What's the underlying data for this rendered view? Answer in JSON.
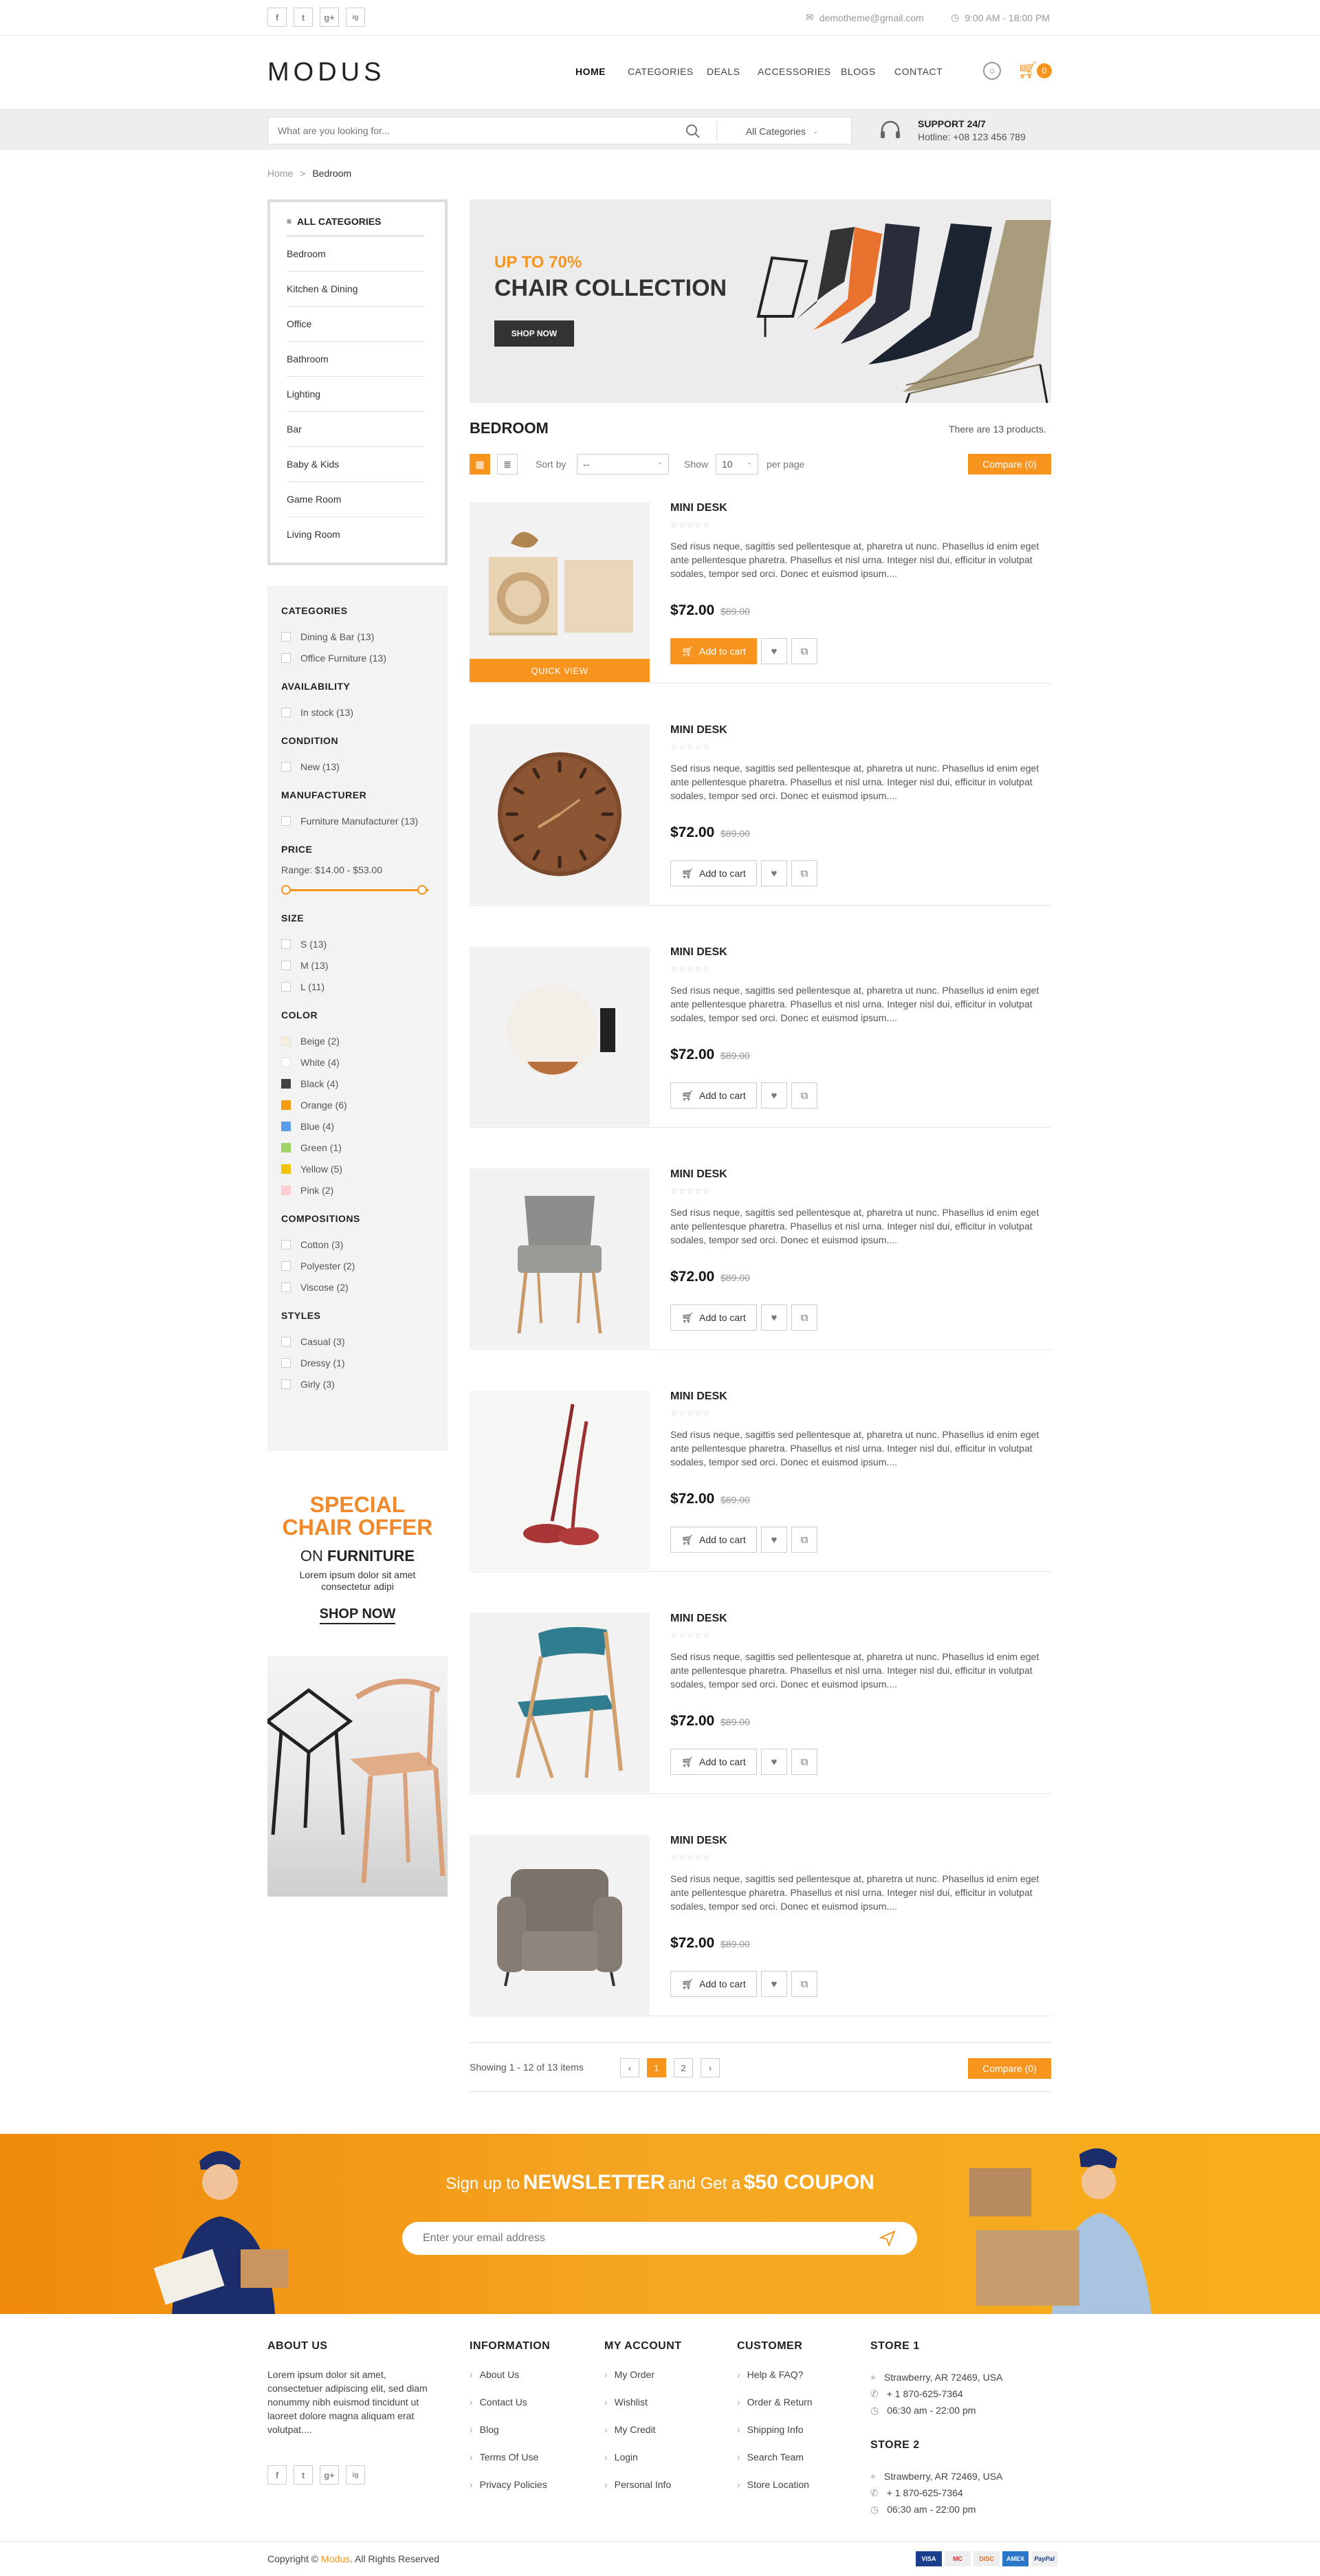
{
  "topbar": {
    "social": [
      "f",
      "t",
      "g+",
      "ig"
    ],
    "email": "demotheme@gmail.com",
    "hours": "9:00 AM - 18:00 PM"
  },
  "header": {
    "logo": "MODUS",
    "nav": [
      "HOME",
      "CATEGORIES",
      "DEALS",
      "ACCESSORIES",
      "BLOGS",
      "CONTACT"
    ],
    "cart_count": "0"
  },
  "search": {
    "placeholder": "What are you looking for...",
    "category": "All Categories",
    "support_title": "SUPPORT 24/7",
    "support_line": "Hotline: +08 123 456 789"
  },
  "breadcrumb": {
    "home": "Home",
    "sep": ">",
    "current": "Bedroom"
  },
  "sidebar": {
    "all_categories": "ALL CATEGORIES",
    "categories": [
      "Bedroom",
      "Kitchen & Dining",
      "Office",
      "Bathroom",
      "Lighting",
      "Bar",
      "Baby & Kids",
      "Game Room",
      "Living Room"
    ]
  },
  "filters": {
    "categories_title": "CATEGORIES",
    "categories": [
      "Dining & Bar (13)",
      "Office Furniture (13)"
    ],
    "availability_title": "AVAILABILITY",
    "availability": [
      "In stock (13)"
    ],
    "condition_title": "CONDITION",
    "condition": [
      "New (13)"
    ],
    "manufacturer_title": "MANUFACTURER",
    "manufacturer": [
      "Furniture Manufacturer (13)"
    ],
    "price_title": "PRICE",
    "price_range": "Range: $14.00 - $53.00",
    "size_title": "SIZE",
    "sizes": [
      "S (13)",
      "M (13)",
      "L (11)"
    ],
    "color_title": "COLOR",
    "colors": [
      {
        "label": "Beige (2)",
        "hex": "#f5f0dc"
      },
      {
        "label": "White (4)",
        "hex": "#ffffff"
      },
      {
        "label": "Black (4)",
        "hex": "#434343"
      },
      {
        "label": "Orange (6)",
        "hex": "#f39c11"
      },
      {
        "label": "Blue (4)",
        "hex": "#5d9cec"
      },
      {
        "label": "Green (1)",
        "hex": "#a0d468"
      },
      {
        "label": "Yellow (5)",
        "hex": "#f1c40f"
      },
      {
        "label": "Pink (2)",
        "hex": "#fcced2"
      }
    ],
    "compositions_title": "COMPOSITIONS",
    "compositions": [
      "Cotton (3)",
      "Polyester (2)",
      "Viscose (2)"
    ],
    "styles_title": "STYLES",
    "styles": [
      "Casual (3)",
      "Dressy (1)",
      "Girly (3)"
    ]
  },
  "promo": {
    "line1": "SPECIAL",
    "line2": "CHAIR OFFER",
    "on": "ON",
    "furniture": "FURNITURE",
    "text": "Lorem ipsum dolor sit amet consectetur adipi",
    "cta": "SHOP NOW"
  },
  "banner": {
    "discount": "UP TO 70%",
    "title": "CHAIR COLLECTION",
    "cta": "SHOP NOW"
  },
  "listing": {
    "title": "BEDROOM",
    "count": "There are 13 products.",
    "sort_label": "Sort by",
    "sort_value": "--",
    "show_label": "Show",
    "show_value": "10",
    "per_page": "per page",
    "compare": "Compare (0)"
  },
  "products": [
    {
      "name": "MINI DESK",
      "desc": "Sed risus neque, sagittis sed pellentesque at, pharetra ut nunc. Phasellus id enim eget ante pellentesque pharetra. Phasellus et nisl urna. Integer nisl dui, efficitur in volutpat sodales, tempor sed orci. Donec et euismod ipsum....",
      "price": "$72.00",
      "old_price": "$89.00",
      "add": "Add to cart",
      "quick_view": "QUICK VIEW"
    },
    {
      "name": "MINI DESK",
      "desc": "Sed risus neque, sagittis sed pellentesque at, pharetra ut nunc. Phasellus id enim eget ante pellentesque pharetra. Phasellus et nisl urna. Integer nisl dui, efficitur in volutpat sodales, tempor sed orci. Donec et euismod ipsum....",
      "price": "$72.00",
      "old_price": "$89.00",
      "add": "Add to cart"
    },
    {
      "name": "MINI DESK",
      "desc": "Sed risus neque, sagittis sed pellentesque at, pharetra ut nunc. Phasellus id enim eget ante pellentesque pharetra. Phasellus et nisl urna. Integer nisl dui, efficitur in volutpat sodales, tempor sed orci. Donec et euismod ipsum....",
      "price": "$72.00",
      "old_price": "$89.00",
      "add": "Add to cart"
    },
    {
      "name": "MINI DESK",
      "desc": "Sed risus neque, sagittis sed pellentesque at, pharetra ut nunc. Phasellus id enim eget ante pellentesque pharetra. Phasellus et nisl urna. Integer nisl dui, efficitur in volutpat sodales, tempor sed orci. Donec et euismod ipsum....",
      "price": "$72.00",
      "old_price": "$89.00",
      "add": "Add to cart"
    },
    {
      "name": "MINI DESK",
      "desc": "Sed risus neque, sagittis sed pellentesque at, pharetra ut nunc. Phasellus id enim eget ante pellentesque pharetra. Phasellus et nisl urna. Integer nisl dui, efficitur in volutpat sodales, tempor sed orci. Donec et euismod ipsum....",
      "price": "$72.00",
      "old_price": "$89.00",
      "add": "Add to cart"
    },
    {
      "name": "MINI DESK",
      "desc": "Sed risus neque, sagittis sed pellentesque at, pharetra ut nunc. Phasellus id enim eget ante pellentesque pharetra. Phasellus et nisl urna. Integer nisl dui, efficitur in volutpat sodales, tempor sed orci. Donec et euismod ipsum....",
      "price": "$72.00",
      "old_price": "$89.00",
      "add": "Add to cart"
    },
    {
      "name": "MINI DESK",
      "desc": "Sed risus neque, sagittis sed pellentesque at, pharetra ut nunc. Phasellus id enim eget ante pellentesque pharetra. Phasellus et nisl urna. Integer nisl dui, efficitur in volutpat sodales, tempor sed orci. Donec et euismod ipsum....",
      "price": "$72.00",
      "old_price": "$89.00",
      "add": "Add to cart"
    }
  ],
  "pagination": {
    "showing": "Showing 1 - 12 of 13 items",
    "prev": "‹",
    "pages": [
      "1",
      "2"
    ],
    "next": "›",
    "compare": "Compare (0)"
  },
  "newsletter": {
    "prefix": "Sign up to",
    "highlight": "NEWSLETTER",
    "middle": "and Get a",
    "coupon": "$50 COUPON",
    "placeholder": "Enter your email address"
  },
  "footer": {
    "about_title": "ABOUT US",
    "about_text": "Lorem ipsum dolor sit amet, consectetuer adipiscing elit, sed diam nonummy nibh euismod tincidunt ut laoreet dolore magna aliquam erat volutpat....",
    "info_title": "INFORMATION",
    "info": [
      "About Us",
      "Contact Us",
      "Blog",
      "Terms Of Use",
      "Privacy Policies"
    ],
    "account_title": "MY ACCOUNT",
    "account": [
      "My Order",
      "Wishlist",
      "My Credit",
      "Login",
      "Personal Info"
    ],
    "customer_title": "CUSTOMER",
    "customer": [
      "Help & FAQ?",
      "Order & Return",
      "Shipping Info",
      "Search Team",
      "Store Location"
    ],
    "store1_title": "STORE 1",
    "store1": [
      "Strawberry, AR 72469, USA",
      "+ 1 870-625-7364",
      "06:30 am - 22:00 pm"
    ],
    "store2_title": "STORE 2",
    "store2": [
      "Strawberry, AR 72469, USA",
      "+ 1 870-625-7364",
      "06:30 am - 22:00 pm"
    ],
    "copyright_prefix": "Copyright ©",
    "copyright_brand": "Modus",
    "copyright_suffix": ". All Rights Reserved",
    "payments": [
      "VISA",
      "MC",
      "DISC",
      "AMEX",
      "PayPal"
    ]
  },
  "colors": {
    "accent": "#f7941d"
  }
}
